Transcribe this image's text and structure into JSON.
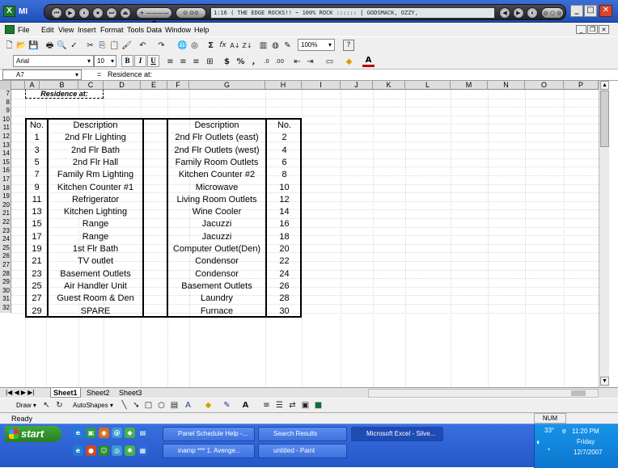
{
  "titlebar": {
    "title": "MI",
    "app_icon": "excel-icon",
    "winamp": {
      "prev": "⏮",
      "play": "▶",
      "pause": "⏸",
      "stop": "⏹",
      "next": "⏭",
      "open": "⏏",
      "pill1": "+ ———— ●",
      "pill2": "⊙ ⊙⊙",
      "ticker": "1:16    ( THE EDGE ROCKS!! ~ 100% ROCK :::::: [ GODSMACK, OZZY,",
      "b1": "◀",
      "b2": "▶",
      "b3": "⏸",
      "tray_pill": "◎ ○ ◎"
    },
    "controls": {
      "minimize": "_",
      "maximize": "□",
      "close": "✕"
    }
  },
  "menubar": {
    "items": [
      "File",
      "Edit",
      "View",
      "Insert",
      "Format",
      "Tools",
      "Data",
      "Window",
      "Help"
    ],
    "mdi": {
      "minimize": "_",
      "restore": "❐",
      "close": "×"
    }
  },
  "toolbar": {
    "zoom": "100%",
    "font_name": "Arial",
    "font_size": "10",
    "bold": "B",
    "italic": "I",
    "underline": "U",
    "sigma": "Σ",
    "fx": "fx",
    "currency": "$",
    "percent": "%",
    "comma": ",",
    "help": "?"
  },
  "formula_bar": {
    "name_box": "A7",
    "equals": "=",
    "content": "Residence at:"
  },
  "columns": [
    "A",
    "B",
    "C",
    "D",
    "E",
    "F",
    "G",
    "H",
    "I",
    "J",
    "K",
    "L",
    "M",
    "N",
    "O",
    "P"
  ],
  "rows": [
    "7",
    "8",
    "9",
    "10",
    "11",
    "12",
    "13",
    "14",
    "15",
    "16",
    "17",
    "18",
    "19",
    "20",
    "21",
    "22",
    "23",
    "24",
    "25",
    "26",
    "27",
    "28",
    "29",
    "30",
    "31",
    "32"
  ],
  "sheet": {
    "residence_label": "Residence at:",
    "header": {
      "no_left": "No.",
      "desc_left": "Description",
      "desc_right": "Description",
      "no_right": "No."
    },
    "table": [
      [
        "1",
        "2nd Flr Lighting",
        "2nd Flr Outlets (east)",
        "2"
      ],
      [
        "3",
        "2nd Flr Bath",
        "2nd Flr Outlets (west)",
        "4"
      ],
      [
        "5",
        "2nd Flr Hall",
        "Family Room Outlets",
        "6"
      ],
      [
        "7",
        "Family Rm Lighting",
        "Kitchen Counter #2",
        "8"
      ],
      [
        "9",
        "Kitchen Counter #1",
        "Microwave",
        "10"
      ],
      [
        "11",
        "Refrigerator",
        "Living Room Outlets",
        "12"
      ],
      [
        "13",
        "Kitchen Lighting",
        "Wine Cooler",
        "14"
      ],
      [
        "15",
        "Range",
        "Jacuzzi",
        "16"
      ],
      [
        "17",
        "Range",
        "Jacuzzi",
        "18"
      ],
      [
        "19",
        "1st Flr Bath",
        "Computer Outlet(Den)",
        "20"
      ],
      [
        "21",
        "TV outlet",
        "Condensor",
        "22"
      ],
      [
        "23",
        "Basement Outlets",
        "Condensor",
        "24"
      ],
      [
        "25",
        "Air Handler Unit",
        "Basement Outlets",
        "26"
      ],
      [
        "27",
        "Guest Room & Den",
        "Laundry",
        "28"
      ],
      [
        "29",
        "SPARE",
        "Furnace",
        "30"
      ]
    ]
  },
  "tabs": {
    "nav": "|◀ ◀ ▶ ▶|",
    "sheets": [
      "Sheet1",
      "Sheet2",
      "Sheet3"
    ]
  },
  "drawing": {
    "draw": "Draw ▾",
    "autoshapes": "AutoShapes ▾"
  },
  "status": {
    "ready": "Ready",
    "num": "NUM"
  },
  "taskbar": {
    "start": "start",
    "tasks": [
      "Panel Schedule Help -...",
      "Search Results",
      "Microsoft Excel - Silve...",
      "inamp *** 1. Avenge...",
      "untitled - Paint"
    ],
    "tray": {
      "time": "11:20 PM",
      "day": "Friday",
      "date": "12/7/2007",
      "temp": "33°"
    }
  }
}
